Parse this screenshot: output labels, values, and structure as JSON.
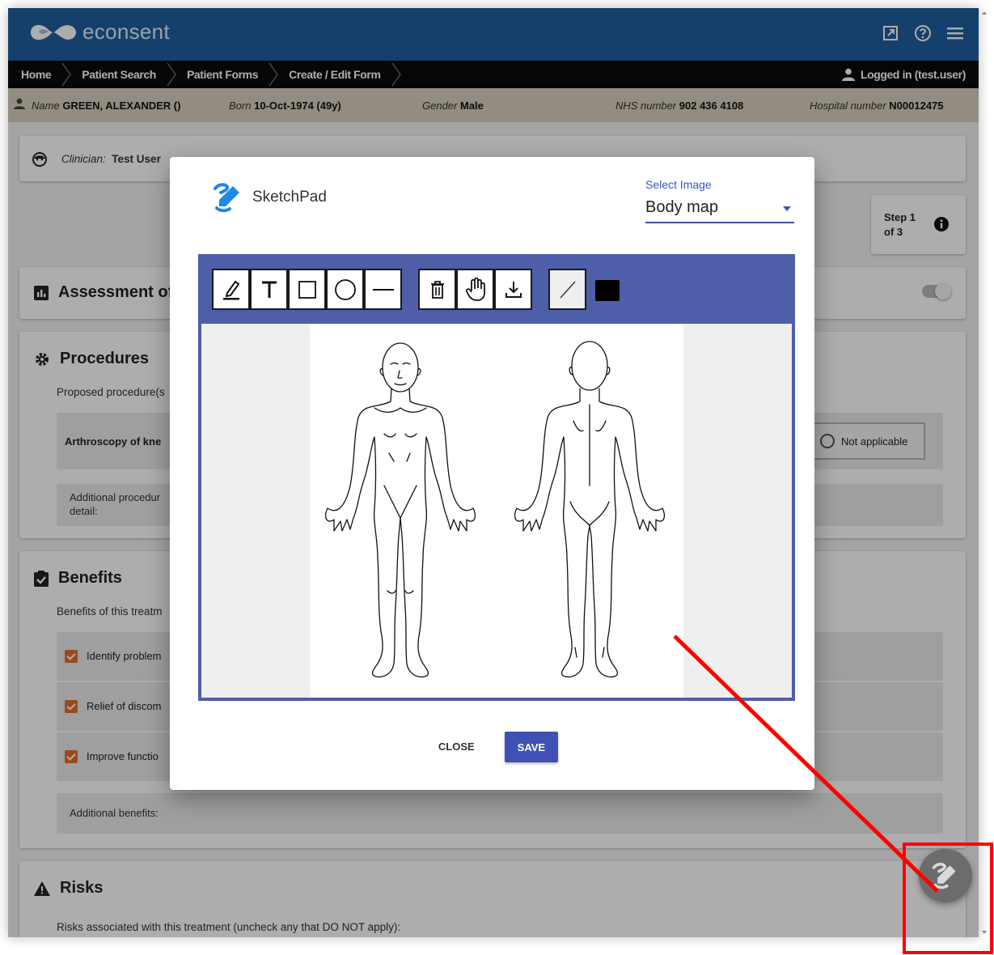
{
  "app": {
    "brand": "econsent"
  },
  "nav": {
    "crumbs": [
      "Home",
      "Patient Search",
      "Patient Forms",
      "Create / Edit Form"
    ],
    "logged_in": "Logged in (test.user)"
  },
  "patient": {
    "name_label": "Name",
    "name": "GREEN, ALEXANDER ()",
    "born_label": "Born",
    "born": "10-Oct-1974 (49y)",
    "gender_label": "Gender",
    "gender": "Male",
    "nhs_label": "NHS number",
    "nhs": "902 436 4108",
    "hosp_label": "Hospital number",
    "hosp": "N00012475"
  },
  "clinician": {
    "label": "Clinician:",
    "value": "Test User"
  },
  "step": {
    "line1": "Step 1",
    "line2": "of 3"
  },
  "sections": {
    "assessment": "Assessment of",
    "procedures": {
      "title": "Procedures",
      "sub": "Proposed procedure(s",
      "item": "Arthroscopy of kne",
      "not_applicable": "Not applicable",
      "additional_1": "Additional procedur",
      "additional_2": "detail:"
    },
    "benefits": {
      "title": "Benefits",
      "sub": "Benefits of this treatm",
      "items": [
        "Identify problem",
        "Relief of discom",
        "Improve functio"
      ],
      "additional": "Additional benefits:"
    },
    "risks": {
      "title": "Risks",
      "sub": "Risks associated with this treatment (uncheck any that DO NOT apply):"
    }
  },
  "dialog": {
    "title": "SketchPad",
    "select_label": "Select Image",
    "select_value": "Body map",
    "close": "CLOSE",
    "save": "SAVE"
  },
  "colors": {
    "header": "#1f5f9e",
    "toolbar": "#4f5ea8",
    "primary": "#3f51b5",
    "checkbox": "#e46c2c",
    "annotation": "#ff0000",
    "current_color": "#000000"
  },
  "icons": {
    "tools": [
      "highlighter-icon",
      "text-icon",
      "rectangle-icon",
      "circle-icon",
      "line-icon",
      "delete-icon",
      "pan-hand-icon",
      "download-icon",
      "line-width-icon"
    ]
  }
}
